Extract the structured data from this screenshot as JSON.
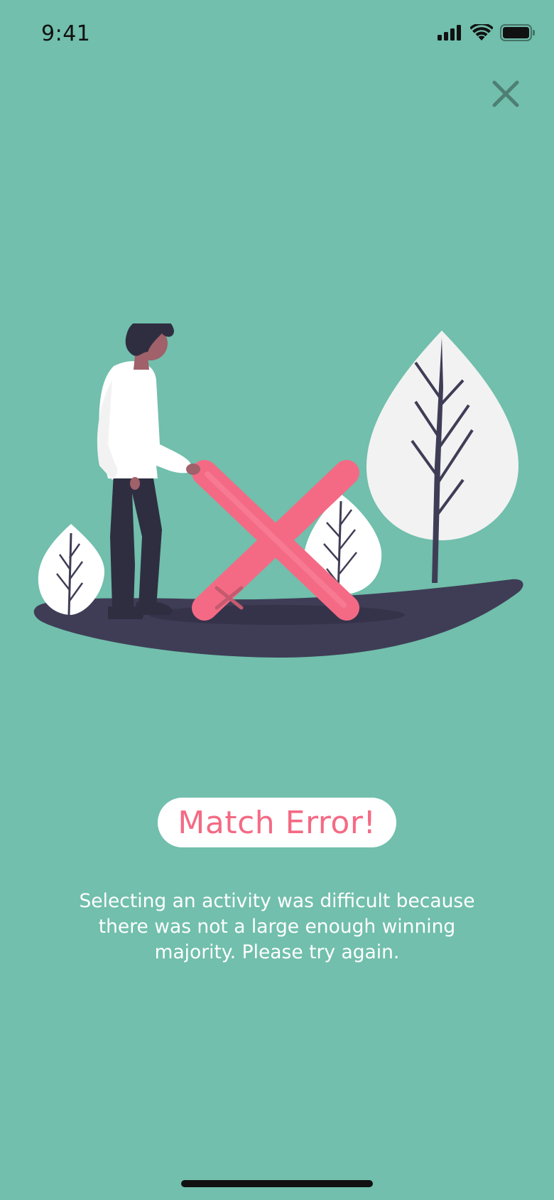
{
  "status_bar": {
    "time": "9:41",
    "icons": [
      "cellular-signal-icon",
      "wifi-icon",
      "battery-icon"
    ]
  },
  "close_button": {
    "icon": "close-icon",
    "color": "#4f7f74"
  },
  "illustration": {
    "description_icon": "person-with-x-mark-illustration"
  },
  "title": {
    "text": "Match Error!",
    "color": "#f46a84"
  },
  "message": {
    "text": "Selecting an activity was difficult because there was not a large enough winning majority. Please try again."
  },
  "colors": {
    "background": "#71bfac",
    "accent": "#f46a84",
    "ground": "#3f3d56",
    "leaf": "#f2f2f2"
  }
}
